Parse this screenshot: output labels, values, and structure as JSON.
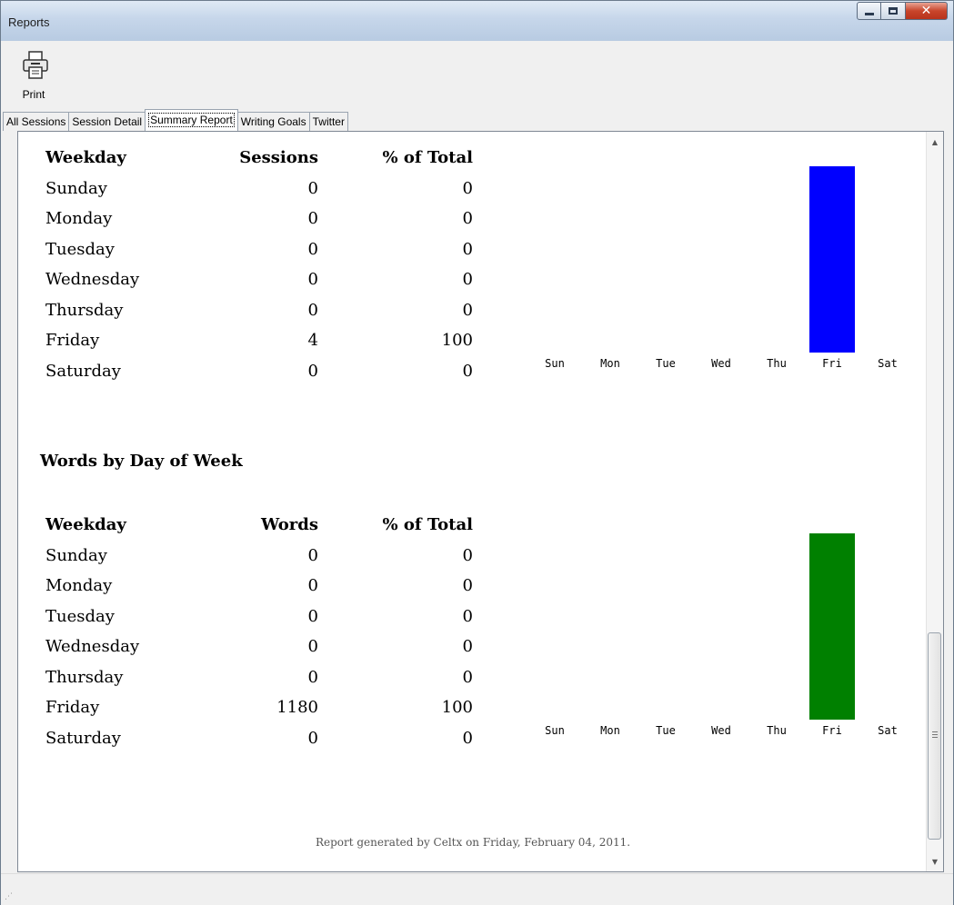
{
  "window": {
    "title": "Reports"
  },
  "toolbar": {
    "print_label": "Print"
  },
  "tabs": [
    {
      "label": "All Sessions"
    },
    {
      "label": "Session Detail"
    },
    {
      "label": "Summary Report"
    },
    {
      "label": "Writing Goals"
    },
    {
      "label": "Twitter"
    }
  ],
  "sessions_table": {
    "headers": [
      "Weekday",
      "Sessions",
      "% of Total"
    ],
    "rows": [
      [
        "Sunday",
        "0",
        "0"
      ],
      [
        "Monday",
        "0",
        "0"
      ],
      [
        "Tuesday",
        "0",
        "0"
      ],
      [
        "Wednesday",
        "0",
        "0"
      ],
      [
        "Thursday",
        "0",
        "0"
      ],
      [
        "Friday",
        "4",
        "100"
      ],
      [
        "Saturday",
        "0",
        "0"
      ]
    ]
  },
  "words_section_title": "Words by Day of Week",
  "words_table": {
    "headers": [
      "Weekday",
      "Words",
      "% of Total"
    ],
    "rows": [
      [
        "Sunday",
        "0",
        "0"
      ],
      [
        "Monday",
        "0",
        "0"
      ],
      [
        "Tuesday",
        "0",
        "0"
      ],
      [
        "Wednesday",
        "0",
        "0"
      ],
      [
        "Thursday",
        "0",
        "0"
      ],
      [
        "Friday",
        "1180",
        "100"
      ],
      [
        "Saturday",
        "0",
        "0"
      ]
    ]
  },
  "footer": "Report generated by Celtx on Friday, February 04, 2011.",
  "chart_data": [
    {
      "type": "bar",
      "categories": [
        "Sun",
        "Mon",
        "Tue",
        "Wed",
        "Thu",
        "Fri",
        "Sat"
      ],
      "values": [
        0,
        0,
        0,
        0,
        0,
        4,
        0
      ],
      "color": "#0000ff"
    },
    {
      "type": "bar",
      "categories": [
        "Sun",
        "Mon",
        "Tue",
        "Wed",
        "Thu",
        "Fri",
        "Sat"
      ],
      "values": [
        0,
        0,
        0,
        0,
        0,
        1180,
        0
      ],
      "color": "#008000"
    }
  ]
}
